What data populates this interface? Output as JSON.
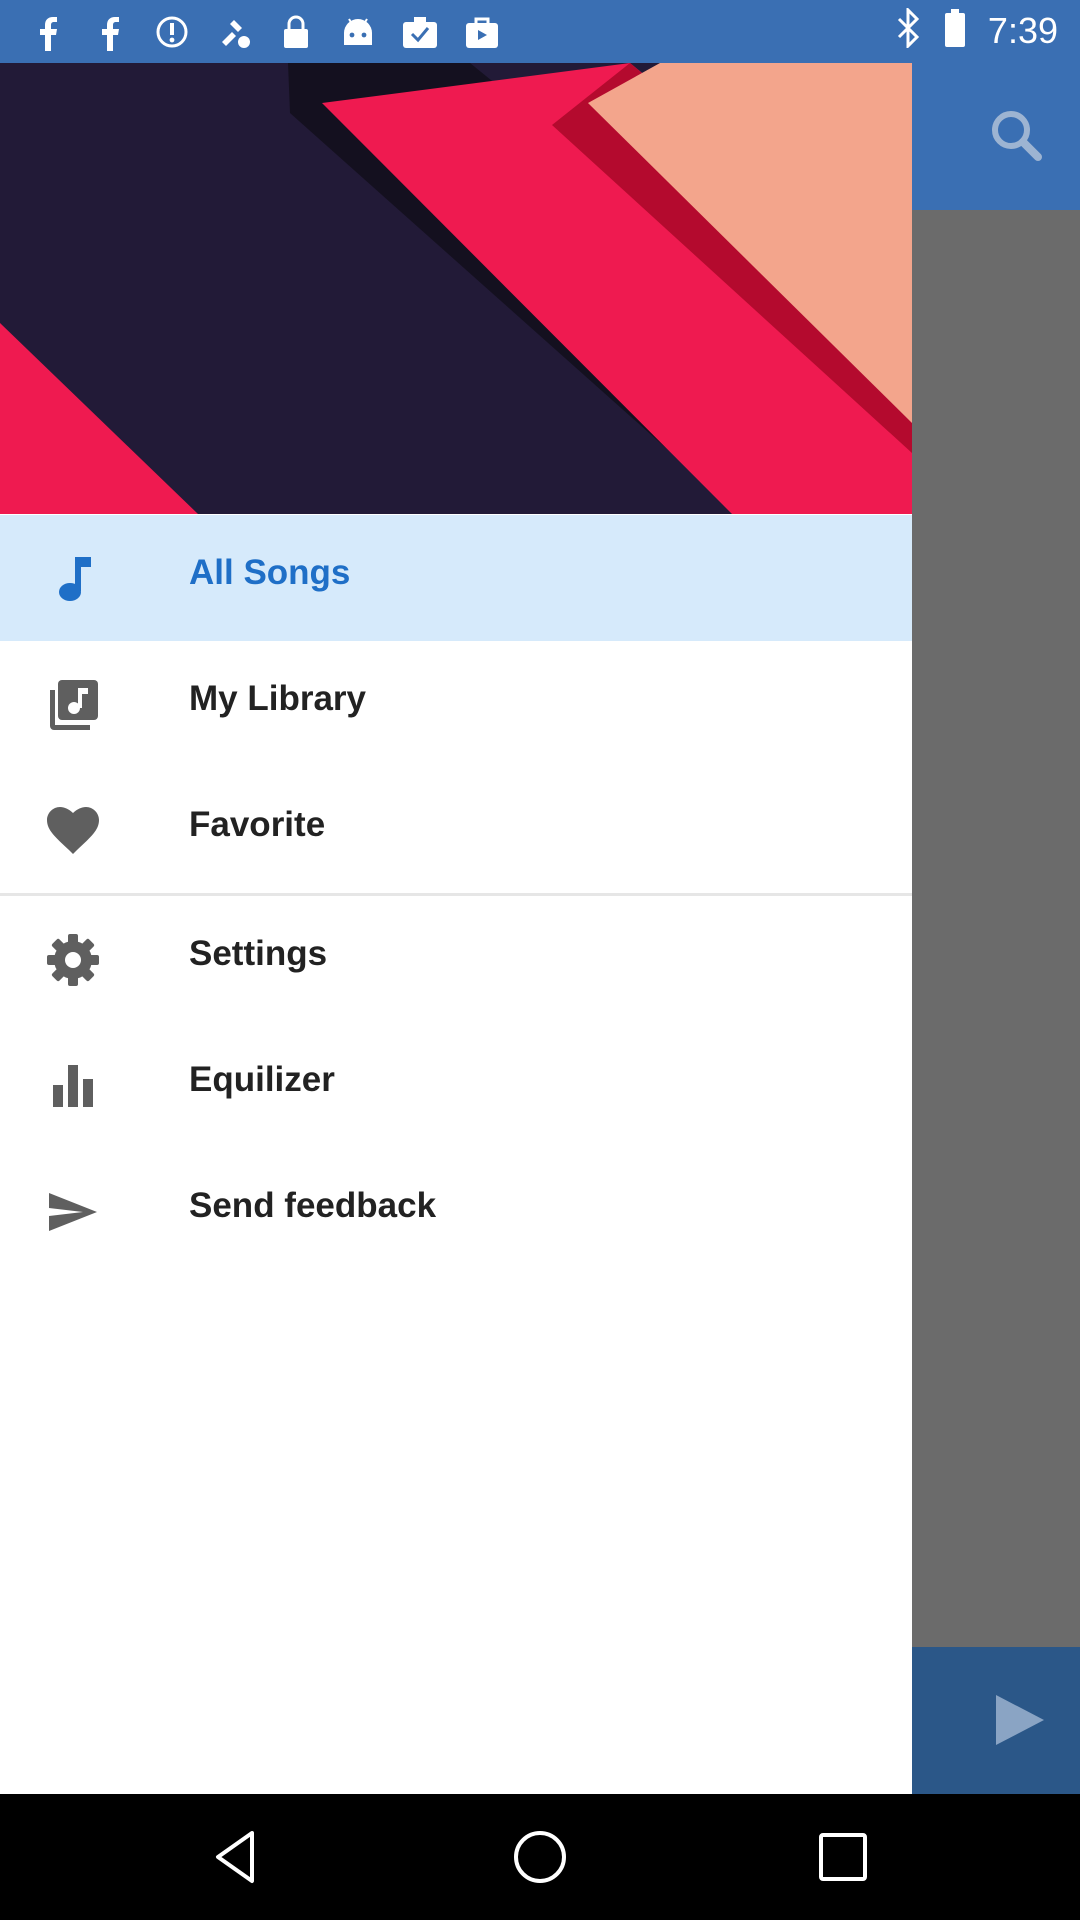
{
  "status_bar": {
    "time": "7:39",
    "left_icons": [
      "facebook-icon",
      "facebook-icon",
      "info-icon",
      "fake-gps-icon",
      "lock-icon",
      "android-icon",
      "task-icon",
      "bag-icon"
    ],
    "right_icons": [
      "bluetooth-icon"
    ]
  },
  "drawer": {
    "menu": [
      {
        "label": "All Songs",
        "icon": "music-note-icon",
        "active": true
      },
      {
        "label": "My Library",
        "icon": "library-music-icon",
        "active": false
      },
      {
        "label": "Favorite",
        "icon": "heart-icon",
        "active": false
      },
      {
        "label": "Settings",
        "icon": "gear-icon",
        "active": false
      },
      {
        "label": "Equilizer",
        "icon": "equalizer-icon",
        "active": false
      },
      {
        "label": "Send feedback",
        "icon": "send-icon",
        "active": false
      }
    ]
  },
  "colors": {
    "primary": "#3a6fb3",
    "active_bg": "#d6eafb",
    "active_text": "#1f6fc7",
    "icon_gray": "#5f5f5f",
    "header_pink": "#ef1a50",
    "header_navy": "#221a37",
    "header_peach": "#f3a58c"
  }
}
